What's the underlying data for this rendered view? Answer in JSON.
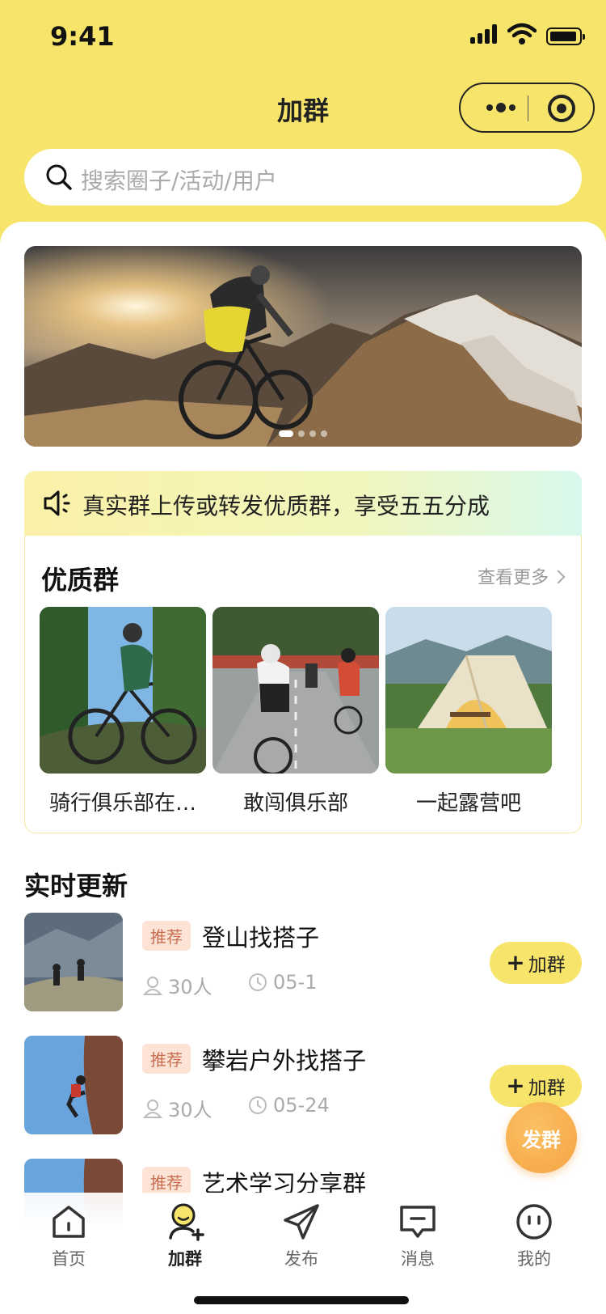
{
  "status_bar": {
    "time": "9:41"
  },
  "nav": {
    "title": "加群"
  },
  "search": {
    "placeholder": "搜索圈子/活动/用户"
  },
  "notice": {
    "text": "真实群上传或转发优质群，享受五五分成"
  },
  "quality": {
    "title": "优质群",
    "more_label": "查看更多",
    "items": [
      {
        "name": "骑行俱乐部在…"
      },
      {
        "name": "敢闯俱乐部"
      },
      {
        "name": "一起露营吧"
      }
    ]
  },
  "realtime": {
    "title": "实时更新",
    "items": [
      {
        "tag": "推荐",
        "name": "登山找搭子",
        "members": "30人",
        "date": "05-1",
        "join_label": "加群"
      },
      {
        "tag": "推荐",
        "name": "攀岩户外找搭子",
        "members": "30人",
        "date": "05-24",
        "join_label": "加群"
      },
      {
        "tag": "推荐",
        "name": "艺术学习分享群"
      }
    ]
  },
  "fab": {
    "label": "发群"
  },
  "tabbar": {
    "items": [
      {
        "label": "首页",
        "icon": "home-icon"
      },
      {
        "label": "加群",
        "icon": "join-group-icon",
        "active": true
      },
      {
        "label": "发布",
        "icon": "send-icon"
      },
      {
        "label": "消息",
        "icon": "message-icon"
      },
      {
        "label": "我的",
        "icon": "profile-icon"
      }
    ]
  },
  "colors": {
    "accent": "#f7e46a",
    "fab": "#f5a343",
    "tag_bg": "#fde3d6",
    "tag_text": "#c77050"
  }
}
